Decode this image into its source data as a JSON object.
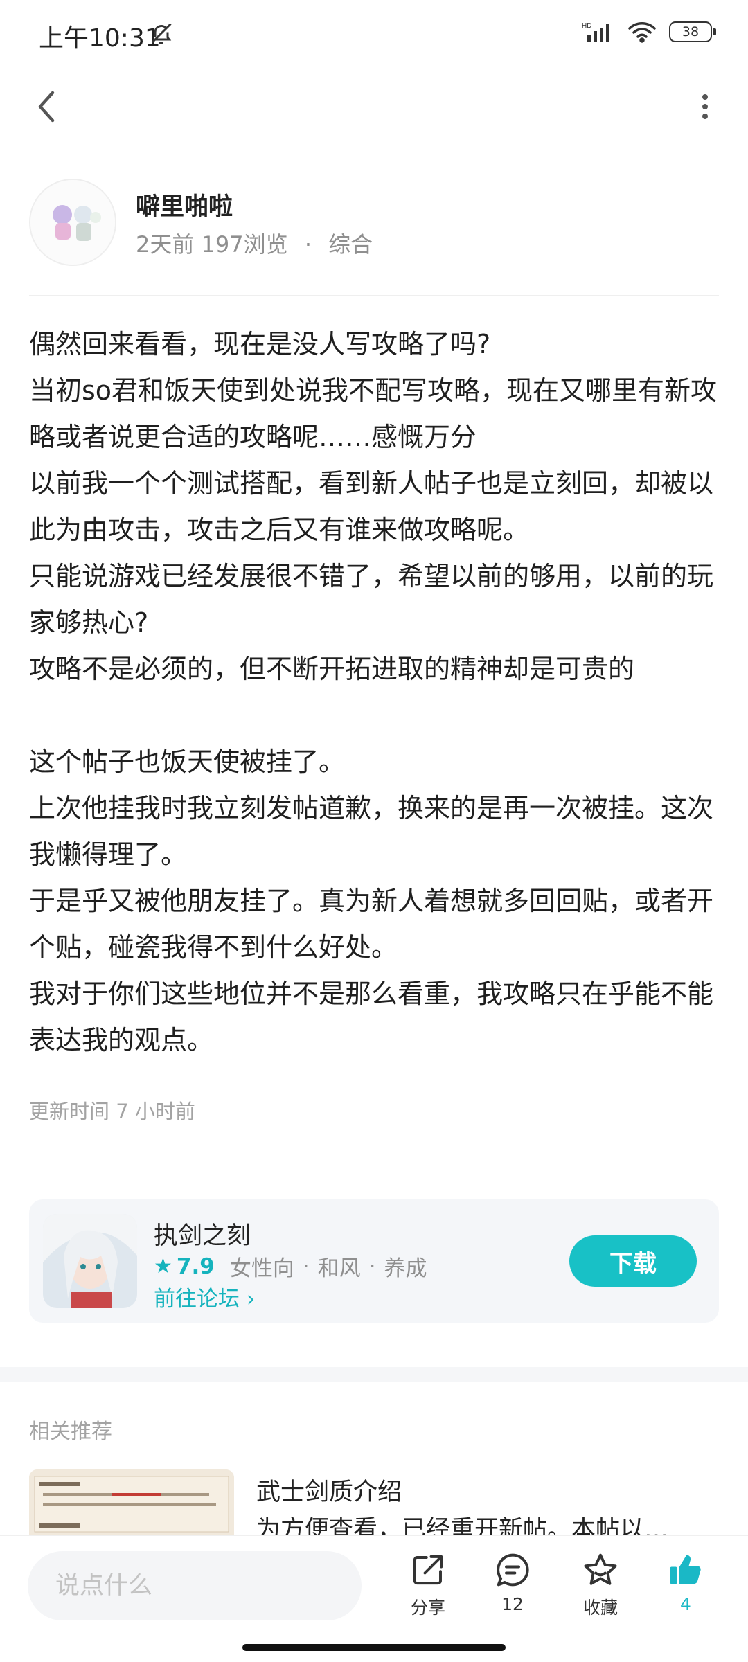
{
  "status_bar": {
    "time": "上午10:31",
    "battery": "38"
  },
  "author": {
    "name": "噼里啪啦",
    "time_ago": "2天前",
    "views": "197浏览",
    "category": "综合"
  },
  "post": {
    "paragraphs": [
      "偶然回来看看，现在是没人写攻略了吗?",
      "当初so君和饭天使到处说我不配写攻略，现在又哪里有新攻略或者说更合适的攻略呢……感慨万分",
      "以前我一个个测试搭配，看到新人帖子也是立刻回，却被以此为由攻击，攻击之后又有谁来做攻略呢。",
      "只能说游戏已经发展很不错了，希望以前的够用，以前的玩家够热心?",
      "攻略不是必须的，但不断开拓进取的精神却是可贵的",
      "这个帖子也饭天使被挂了。",
      "上次他挂我时我立刻发帖道歉，换来的是再一次被挂。这次我懒得理了。",
      "于是乎又被他朋友挂了。真为新人着想就多回回贴，或者开个贴，碰瓷我得不到什么好处。",
      "我对于你们这些地位并不是那么看重，我攻略只在乎能不能表达我的观点。"
    ],
    "update_time": "更新时间 7 小时前"
  },
  "game_card": {
    "name": "执剑之刻",
    "rating": "7.9",
    "tags": [
      "女性向",
      "和风",
      "养成"
    ],
    "forum_link": "前往论坛",
    "download_label": "下载"
  },
  "related": {
    "title": "相关推荐",
    "items": [
      {
        "name": "武士剑质介绍",
        "desc": "为方便查看，已经重开新帖。本帖以…"
      }
    ]
  },
  "bottom_bar": {
    "comment_placeholder": "说点什么",
    "share_label": "分享",
    "comment_count": "12",
    "favorite_label": "收藏",
    "like_count": "4"
  },
  "colors": {
    "accent": "#18c1c6",
    "accent_text": "#15b3bd"
  }
}
